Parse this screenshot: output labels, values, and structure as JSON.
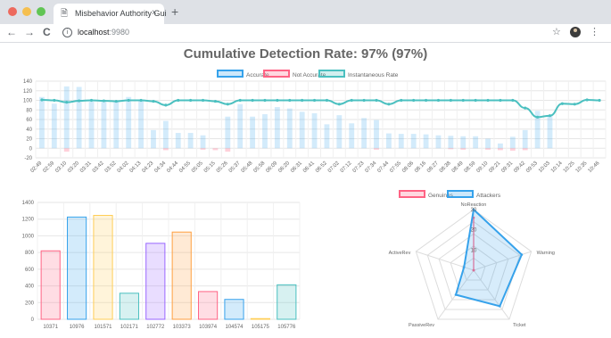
{
  "browser": {
    "tab_title": "Misbehavior Authority Gui",
    "tab_close": "×",
    "new_tab": "+",
    "url_host": "localhost",
    "url_port": ":9980",
    "icons": {
      "back": "arrow-left-icon",
      "forward": "arrow-right-icon",
      "reload": "reload-icon",
      "info": "info-icon",
      "bookmark": "star-icon",
      "menu": "kebab-menu-icon"
    },
    "dots": {
      "close": "#ed6a5e",
      "minimize": "#f5bf4f",
      "maximize": "#61c554"
    }
  },
  "chart_data": [
    {
      "type": "bar+line",
      "title": "Cumulative Detection Rate: 97% (97%)",
      "legend_position": "top-center",
      "ylim": [
        -20,
        140
      ],
      "yticks": [
        -20,
        0,
        20,
        40,
        60,
        80,
        100,
        120,
        140
      ],
      "grid": true,
      "categories": [
        "02:49",
        "02:59",
        "03:10",
        "03:20",
        "03:31",
        "03:42",
        "03:52",
        "04:02",
        "04:13",
        "04:23",
        "04:34",
        "04:44",
        "04:55",
        "05:05",
        "05:15",
        "05:26",
        "05:37",
        "05:48",
        "05:58",
        "06:09",
        "06:20",
        "06:31",
        "06:41",
        "06:52",
        "07:02",
        "07:12",
        "07:23",
        "07:34",
        "07:44",
        "07:55",
        "08:06",
        "08:16",
        "08:27",
        "08:38",
        "08:49",
        "08:59",
        "09:10",
        "09:21",
        "09:31",
        "09:42",
        "09:53",
        "10:03",
        "10:14",
        "10:25",
        "10:35",
        "10:46"
      ],
      "series": [
        {
          "name": "Accurate",
          "kind": "bar",
          "color": "#36a2eb",
          "values": [
            107,
            93,
            129,
            128,
            97,
            100,
            97,
            107,
            100,
            38,
            57,
            32,
            32,
            27,
            0,
            66,
            92,
            66,
            71,
            86,
            83,
            76,
            73,
            50,
            69,
            52,
            63,
            59,
            31,
            30,
            30,
            29,
            27,
            26,
            25,
            25,
            20,
            10,
            24,
            38,
            78,
            68
          ]
        },
        {
          "name": "Not Accurate",
          "kind": "bar",
          "color": "#ff6384",
          "values": [
            0,
            0,
            -7,
            0,
            0,
            0,
            0,
            0,
            0,
            0,
            -4,
            0,
            0,
            -3,
            -4,
            -7,
            0,
            0,
            0,
            0,
            0,
            0,
            0,
            0,
            0,
            0,
            0,
            -3,
            0,
            0,
            0,
            0,
            0,
            -2,
            -3,
            0,
            -3,
            -4,
            -5,
            -4,
            0,
            0
          ]
        },
        {
          "name": "Instantaneous Rate",
          "kind": "line",
          "color": "#4bc0c0",
          "values": [
            101,
            100,
            96,
            99,
            100,
            99,
            98,
            100,
            100,
            98,
            90,
            100,
            100,
            100,
            98,
            92,
            100,
            100,
            100,
            100,
            100,
            100,
            100,
            100,
            92,
            100,
            100,
            100,
            92,
            100,
            100,
            100,
            100,
            100,
            100,
            100,
            100,
            100,
            100,
            84,
            65,
            68,
            93,
            92,
            101,
            100
          ]
        }
      ]
    },
    {
      "type": "bar",
      "ylim": [
        0,
        1400
      ],
      "yticks": [
        0,
        200,
        400,
        600,
        800,
        1000,
        1200,
        1400
      ],
      "grid": true,
      "categories": [
        "10371",
        "10976",
        "101571",
        "102171",
        "102772",
        "103373",
        "103974",
        "104574",
        "105175",
        "105776"
      ],
      "values": [
        820,
        1225,
        1245,
        312,
        910,
        1045,
        332,
        238,
        8,
        413
      ],
      "colors": [
        "#ff6384",
        "#36a2eb",
        "#ffce56",
        "#4bc0c0",
        "#9966ff",
        "#ff9f40",
        "#ff6384",
        "#36a2eb",
        "#ffce56",
        "#4bc0c0"
      ]
    },
    {
      "type": "radar",
      "legend_position": "top-center",
      "axes": [
        "NoReaction",
        "Warning",
        "Ticket",
        "PassiveRev",
        "ActiveRev"
      ],
      "rlim": [
        0,
        30
      ],
      "rticks": [
        10,
        20,
        30
      ],
      "series": [
        {
          "name": "Genuines",
          "color": "#ff6384",
          "values": [
            26,
            0,
            0,
            0,
            0
          ]
        },
        {
          "name": "Attackers",
          "color": "#36a2eb",
          "values": [
            30,
            25,
            22,
            15,
            5
          ]
        }
      ]
    }
  ]
}
